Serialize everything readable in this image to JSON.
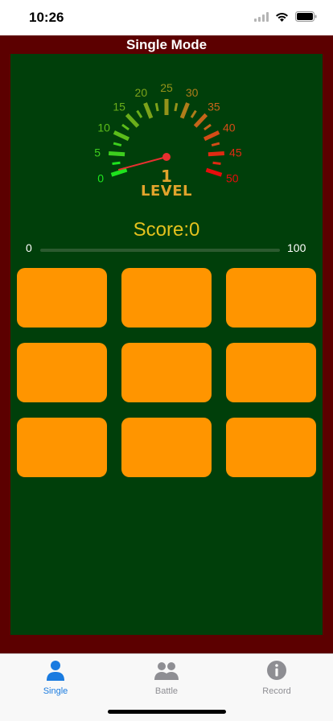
{
  "status_bar": {
    "time": "10:26"
  },
  "header": {
    "title": "Single Mode"
  },
  "gauge": {
    "ticks": [
      "0",
      "5",
      "10",
      "15",
      "20",
      "25",
      "30",
      "35",
      "40",
      "45",
      "50"
    ],
    "level_value": "1",
    "level_label": "LEVEL"
  },
  "score": {
    "text": "Score:0",
    "progress_min": "0",
    "progress_max": "100",
    "progress_fraction": 0
  },
  "tiles": {
    "count": 9,
    "color": "#ff9500"
  },
  "tabs": [
    {
      "label": "Single",
      "active": true
    },
    {
      "label": "Battle",
      "active": false
    },
    {
      "label": "Record",
      "active": false
    }
  ],
  "colors": {
    "frame": "#5c0000",
    "board": "#003f0a",
    "level": "#e1a42c",
    "score": "#e4c21e",
    "tab_active": "#1a7be0",
    "tab_inactive": "#8e8e93"
  }
}
